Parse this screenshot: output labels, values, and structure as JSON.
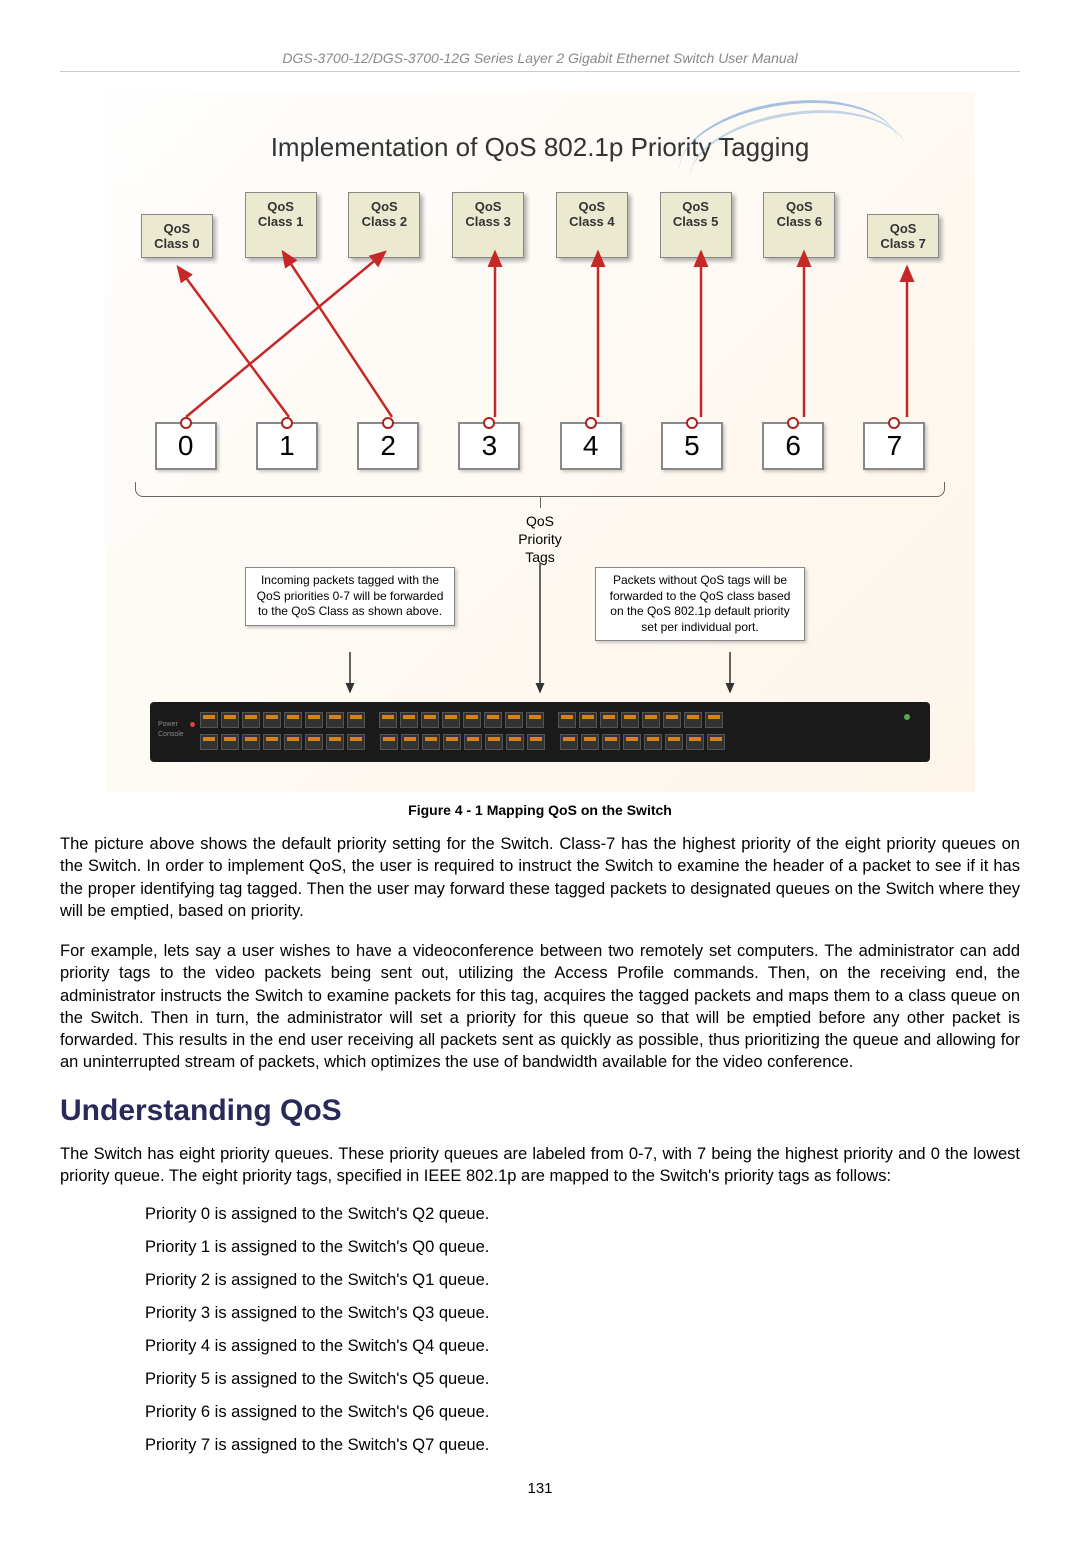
{
  "header": "DGS-3700-12/DGS-3700-12G Series Layer 2 Gigabit Ethernet Switch User Manual",
  "diagram": {
    "title": "Implementation of QoS 802.1p Priority Tagging",
    "classes": [
      {
        "label1": "QoS",
        "label2": "Class 0"
      },
      {
        "label1": "QoS",
        "label2": "Class 1"
      },
      {
        "label1": "QoS",
        "label2": "Class 2"
      },
      {
        "label1": "QoS",
        "label2": "Class 3"
      },
      {
        "label1": "QoS",
        "label2": "Class 4"
      },
      {
        "label1": "QoS",
        "label2": "Class 5"
      },
      {
        "label1": "QoS",
        "label2": "Class 6"
      },
      {
        "label1": "QoS",
        "label2": "Class 7"
      }
    ],
    "priority_tags": [
      "0",
      "1",
      "2",
      "3",
      "4",
      "5",
      "6",
      "7"
    ],
    "tags_label": "QoS\nPriority\nTags",
    "info_left": "Incoming packets tagged with the QoS priorities 0-7 will be forwarded to the QoS Class as shown above.",
    "info_right": "Packets without QoS tags will be forwarded to the QoS class based on the QoS 802.1p default priority set per individual port."
  },
  "chart_data": {
    "type": "diagram",
    "title": "Implementation of QoS 802.1p Priority Tagging",
    "mapping": [
      {
        "priority_tag": 0,
        "qos_class": 2
      },
      {
        "priority_tag": 1,
        "qos_class": 0
      },
      {
        "priority_tag": 2,
        "qos_class": 1
      },
      {
        "priority_tag": 3,
        "qos_class": 3
      },
      {
        "priority_tag": 4,
        "qos_class": 4
      },
      {
        "priority_tag": 5,
        "qos_class": 5
      },
      {
        "priority_tag": 6,
        "qos_class": 6
      },
      {
        "priority_tag": 7,
        "qos_class": 7
      }
    ],
    "description": "Arrows from priority tags 0-7 point to QoS Classes: tag 0→Class 2, tag 1→Class 0, tag 2→Class 1; tags 3-7 map straight to Classes 3-7."
  },
  "figure_caption": "Figure 4 - 1 Mapping QoS on the Switch",
  "para1": "The picture above shows the default priority setting for the Switch. Class-7 has the highest priority of the eight priority queues on the Switch. In order to implement QoS, the user is required to instruct the Switch to examine the header of a packet to see if it has the proper identifying tag tagged. Then the user may forward these tagged packets to designated queues on the Switch where they will be emptied, based on priority.",
  "para2": "For example, lets say a user wishes to have a videoconference between two remotely set computers. The administrator can add priority tags to the video packets being sent out, utilizing the Access Profile commands. Then, on the receiving end, the administrator instructs the Switch to examine packets for this tag, acquires the tagged packets and maps them to a class queue on the Switch. Then in turn, the administrator will set a priority for this queue so that will be emptied before any other packet is forwarded. This results in the end user receiving all packets sent as quickly as possible, thus prioritizing the queue and allowing for an uninterrupted stream of packets, which optimizes the use of bandwidth available for the video conference.",
  "section_heading": "Understanding QoS",
  "para3": "The Switch has eight priority queues. These priority queues are labeled from 0-7, with 7 being the highest priority and 0 the lowest priority queue. The eight priority tags, specified in IEEE 802.1p are mapped to the Switch's priority tags as follows:",
  "priority_items": [
    "Priority 0 is assigned to the Switch's Q2 queue.",
    "Priority 1 is assigned to the Switch's Q0 queue.",
    "Priority 2 is assigned to the Switch's Q1 queue.",
    "Priority 3 is assigned to the Switch's Q3 queue.",
    "Priority 4 is assigned to the Switch's Q4 queue.",
    "Priority 5 is assigned to the Switch's Q5 queue.",
    "Priority 6 is assigned to the Switch's Q6 queue.",
    "Priority 7 is assigned to the Switch's Q7 queue."
  ],
  "page_number": "131"
}
